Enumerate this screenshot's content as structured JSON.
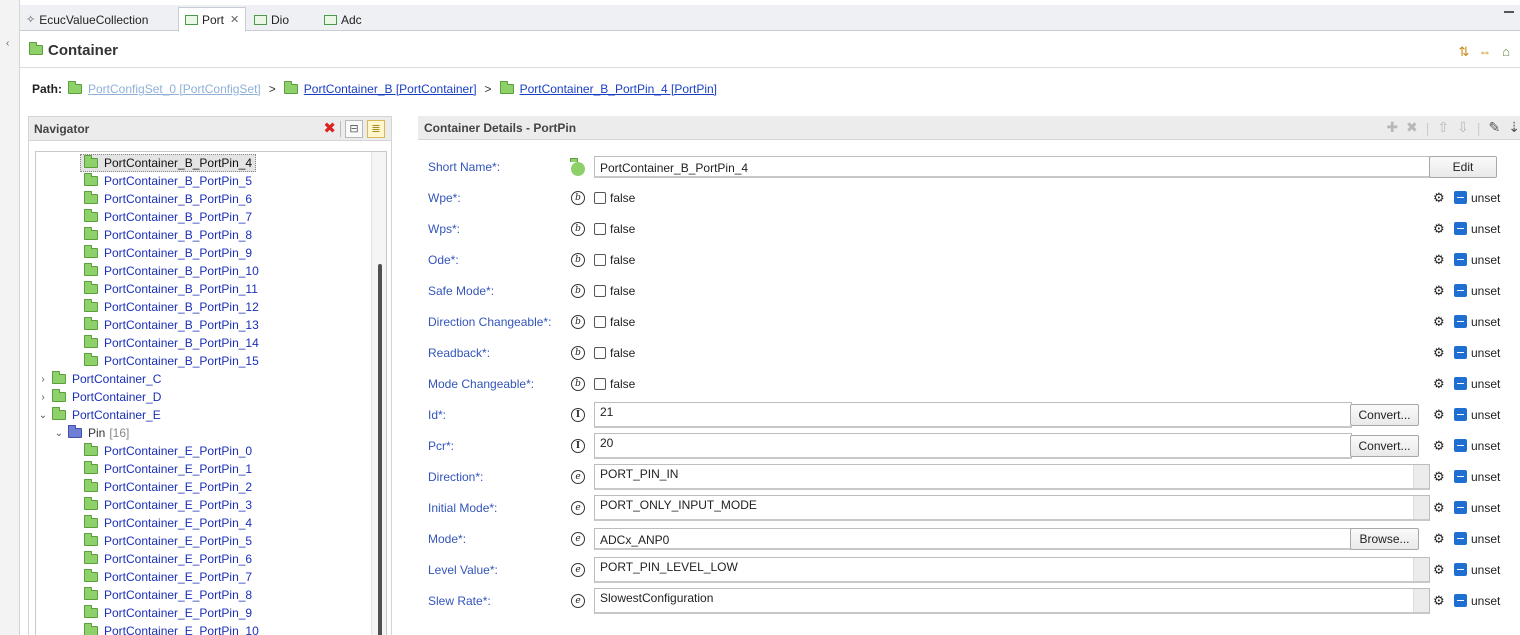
{
  "tabs": [
    {
      "label": "EcucValueCollection",
      "icon": "star-icon"
    },
    {
      "label": "Port",
      "icon": "editor-icon",
      "active": true,
      "closable": true
    },
    {
      "label": "Dio",
      "icon": "editor-icon"
    },
    {
      "label": "Adc",
      "icon": "editor-icon"
    }
  ],
  "header": {
    "title": "Container"
  },
  "path": {
    "label": "Path:",
    "segments": [
      "PortConfigSet_0 [PortConfigSet]",
      "PortContainer_B [PortContainer]",
      "PortContainer_B_PortPin_4 [PortPin]"
    ],
    "separator": ">"
  },
  "navigator": {
    "title": "Navigator",
    "items": [
      {
        "label": "PortContainer_B_PortPin_4",
        "indent": 2,
        "selected": true
      },
      {
        "label": "PortContainer_B_PortPin_5",
        "indent": 2
      },
      {
        "label": "PortContainer_B_PortPin_6",
        "indent": 2
      },
      {
        "label": "PortContainer_B_PortPin_7",
        "indent": 2
      },
      {
        "label": "PortContainer_B_PortPin_8",
        "indent": 2
      },
      {
        "label": "PortContainer_B_PortPin_9",
        "indent": 2
      },
      {
        "label": "PortContainer_B_PortPin_10",
        "indent": 2
      },
      {
        "label": "PortContainer_B_PortPin_11",
        "indent": 2
      },
      {
        "label": "PortContainer_B_PortPin_12",
        "indent": 2
      },
      {
        "label": "PortContainer_B_PortPin_13",
        "indent": 2
      },
      {
        "label": "PortContainer_B_PortPin_14",
        "indent": 2
      },
      {
        "label": "PortContainer_B_PortPin_15",
        "indent": 2
      },
      {
        "label": "PortContainer_C",
        "indent": 0,
        "chevron": "right"
      },
      {
        "label": "PortContainer_D",
        "indent": 0,
        "chevron": "right"
      },
      {
        "label": "PortContainer_E",
        "indent": 0,
        "chevron": "down"
      },
      {
        "label": "Pin",
        "count": "[16]",
        "indent": 1,
        "chevron": "down",
        "folder": "blue"
      },
      {
        "label": "PortContainer_E_PortPin_0",
        "indent": 2
      },
      {
        "label": "PortContainer_E_PortPin_1",
        "indent": 2
      },
      {
        "label": "PortContainer_E_PortPin_2",
        "indent": 2
      },
      {
        "label": "PortContainer_E_PortPin_3",
        "indent": 2
      },
      {
        "label": "PortContainer_E_PortPin_4",
        "indent": 2
      },
      {
        "label": "PortContainer_E_PortPin_5",
        "indent": 2
      },
      {
        "label": "PortContainer_E_PortPin_6",
        "indent": 2
      },
      {
        "label": "PortContainer_E_PortPin_7",
        "indent": 2
      },
      {
        "label": "PortContainer_E_PortPin_8",
        "indent": 2
      },
      {
        "label": "PortContainer_E_PortPin_9",
        "indent": 2
      },
      {
        "label": "PortContainer_E_PortPin_10",
        "indent": 2
      }
    ]
  },
  "details": {
    "title": "Container Details - PortPin",
    "unset_label": "unset",
    "fields": [
      {
        "label": "Short Name*:",
        "type": "shortname",
        "value": "PortContainer_B_PortPin_4",
        "button": "Edit"
      },
      {
        "label": "Wpe*:",
        "type": "boolean",
        "value": "false"
      },
      {
        "label": "Wps*:",
        "type": "boolean",
        "value": "false"
      },
      {
        "label": "Ode*:",
        "type": "boolean",
        "value": "false"
      },
      {
        "label": "Safe Mode*:",
        "type": "boolean",
        "value": "false"
      },
      {
        "label": "Direction Changeable*:",
        "type": "boolean",
        "value": "false"
      },
      {
        "label": "Readback*:",
        "type": "boolean",
        "value": "false"
      },
      {
        "label": "Mode Changeable*:",
        "type": "boolean",
        "value": "false"
      },
      {
        "label": "Id*:",
        "type": "integer",
        "value": "21",
        "button": "Convert..."
      },
      {
        "label": "Pcr*:",
        "type": "integer",
        "value": "20",
        "button": "Convert..."
      },
      {
        "label": "Direction*:",
        "type": "enum",
        "value": "PORT_PIN_IN"
      },
      {
        "label": "Initial Mode*:",
        "type": "enum",
        "value": "PORT_ONLY_INPUT_MODE"
      },
      {
        "label": "Mode*:",
        "type": "reference",
        "value": "ADCx_ANP0",
        "button": "Browse..."
      },
      {
        "label": "Level Value*:",
        "type": "enum",
        "value": "PORT_PIN_LEVEL_LOW"
      },
      {
        "label": "Slew Rate*:",
        "type": "enum",
        "value": "SlowestConfiguration"
      }
    ]
  }
}
